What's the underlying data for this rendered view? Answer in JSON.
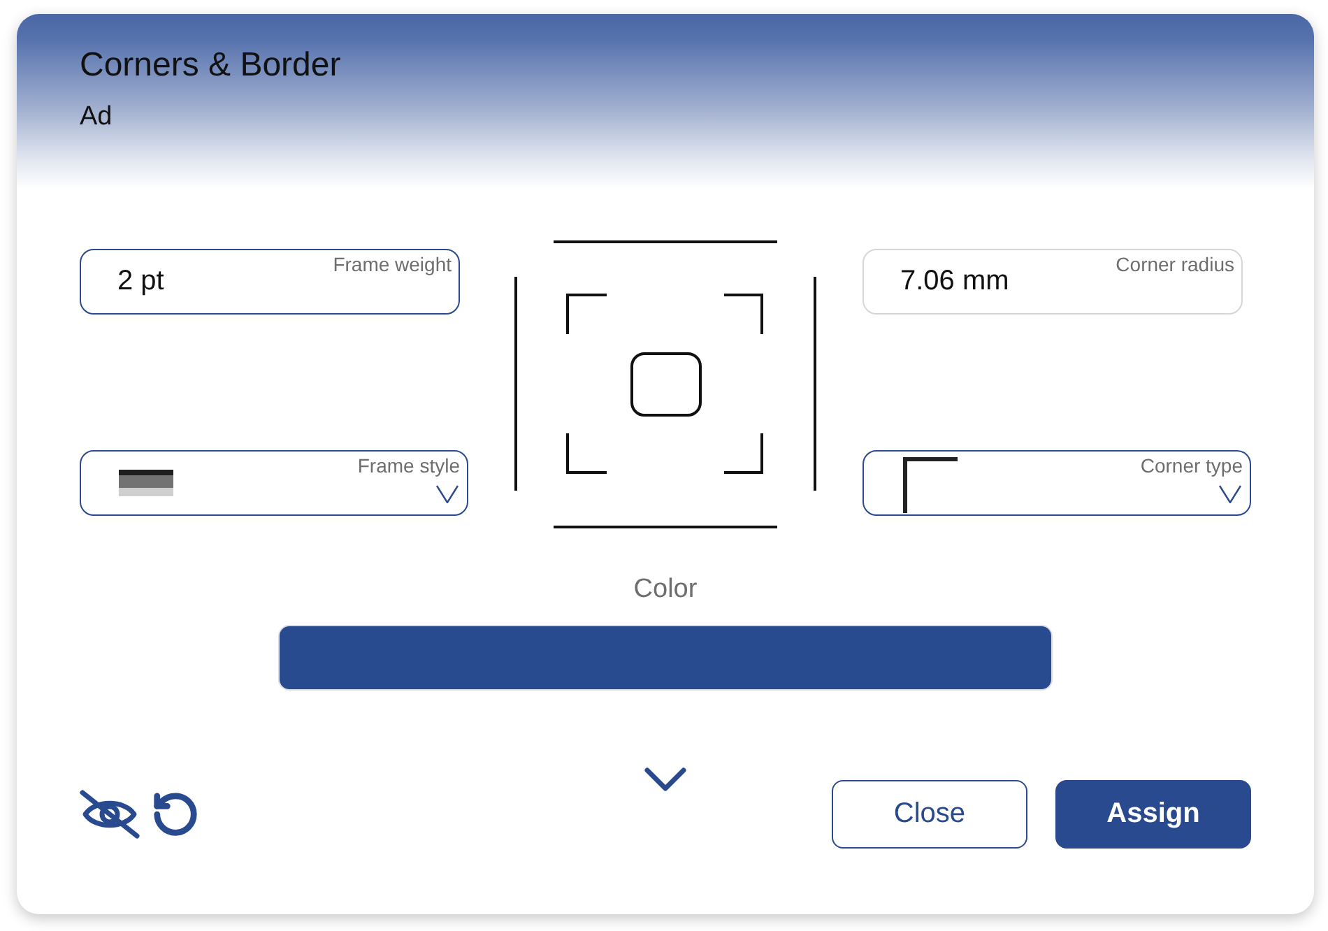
{
  "dialog": {
    "title": "Corners & Border",
    "subtitle": "Ad"
  },
  "frame_weight": {
    "label": "Frame weight",
    "value": "2 pt",
    "disabled": false
  },
  "corner_radius": {
    "label": "Corner radius",
    "value": "7.06 mm",
    "disabled": true
  },
  "frame_style": {
    "label": "Frame style"
  },
  "corner_type": {
    "label": "Corner type"
  },
  "color_picker": {
    "label": "Color",
    "color": "#284a8f"
  },
  "more_options": {
    "expanded": false
  },
  "buttons": [
    {
      "label": "Close",
      "kind": "secondary"
    },
    {
      "label": "Assign",
      "kind": "primary"
    }
  ]
}
